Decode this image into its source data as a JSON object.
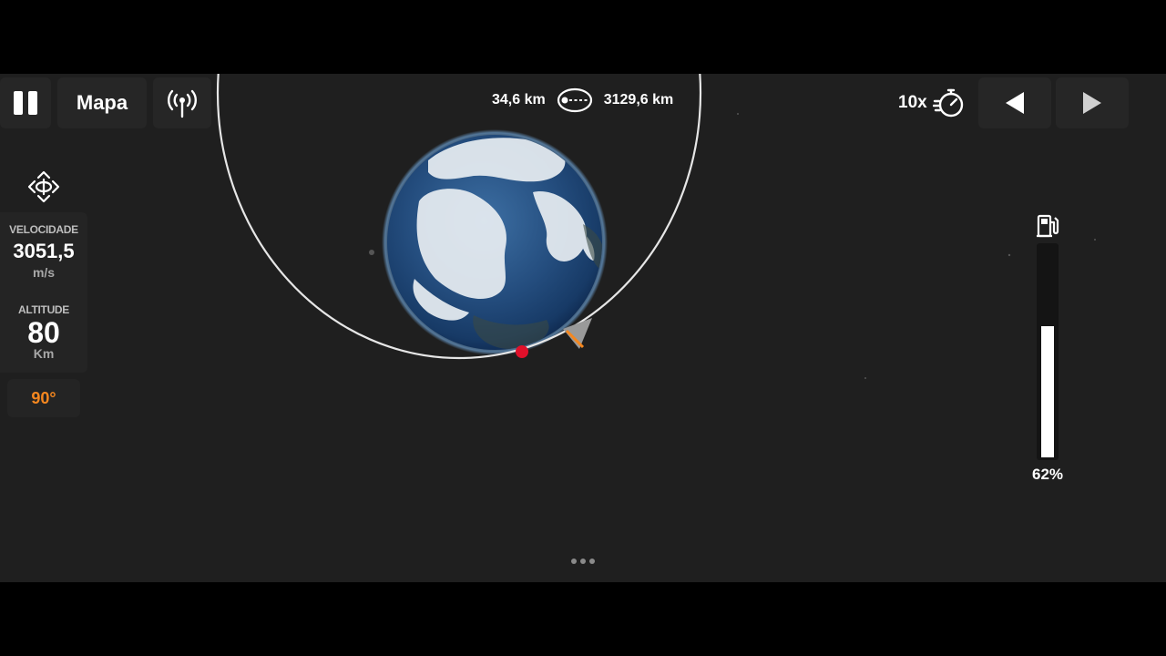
{
  "toolbar": {
    "pause_icon": "pause-icon",
    "map_label": "Mapa",
    "signal_icon": "antenna-signal-icon",
    "prev_icon": "triangle-left-icon",
    "next_icon": "triangle-right-icon"
  },
  "orbit": {
    "periapsis": "34,6 km",
    "apoapsis": "3129,6 km",
    "icon": "orbit-ellipse-icon"
  },
  "timewarp": {
    "label": "10x",
    "icon": "stopwatch-icon"
  },
  "telemetry": {
    "velocity_label": "VELOCIDADE",
    "velocity_value": "3051,5",
    "velocity_unit": "m/s",
    "altitude_label": "ALTITUDE",
    "altitude_value": "80",
    "altitude_unit": "Km",
    "angle": "90°",
    "rotate_icon": "rotate-view-icon"
  },
  "fuel": {
    "icon": "fuel-pump-icon",
    "percent_label": "62%",
    "level": 0.62
  },
  "colors": {
    "angle": "#f5871f",
    "background": "#1f1f1f",
    "marker": "#e0102a"
  }
}
